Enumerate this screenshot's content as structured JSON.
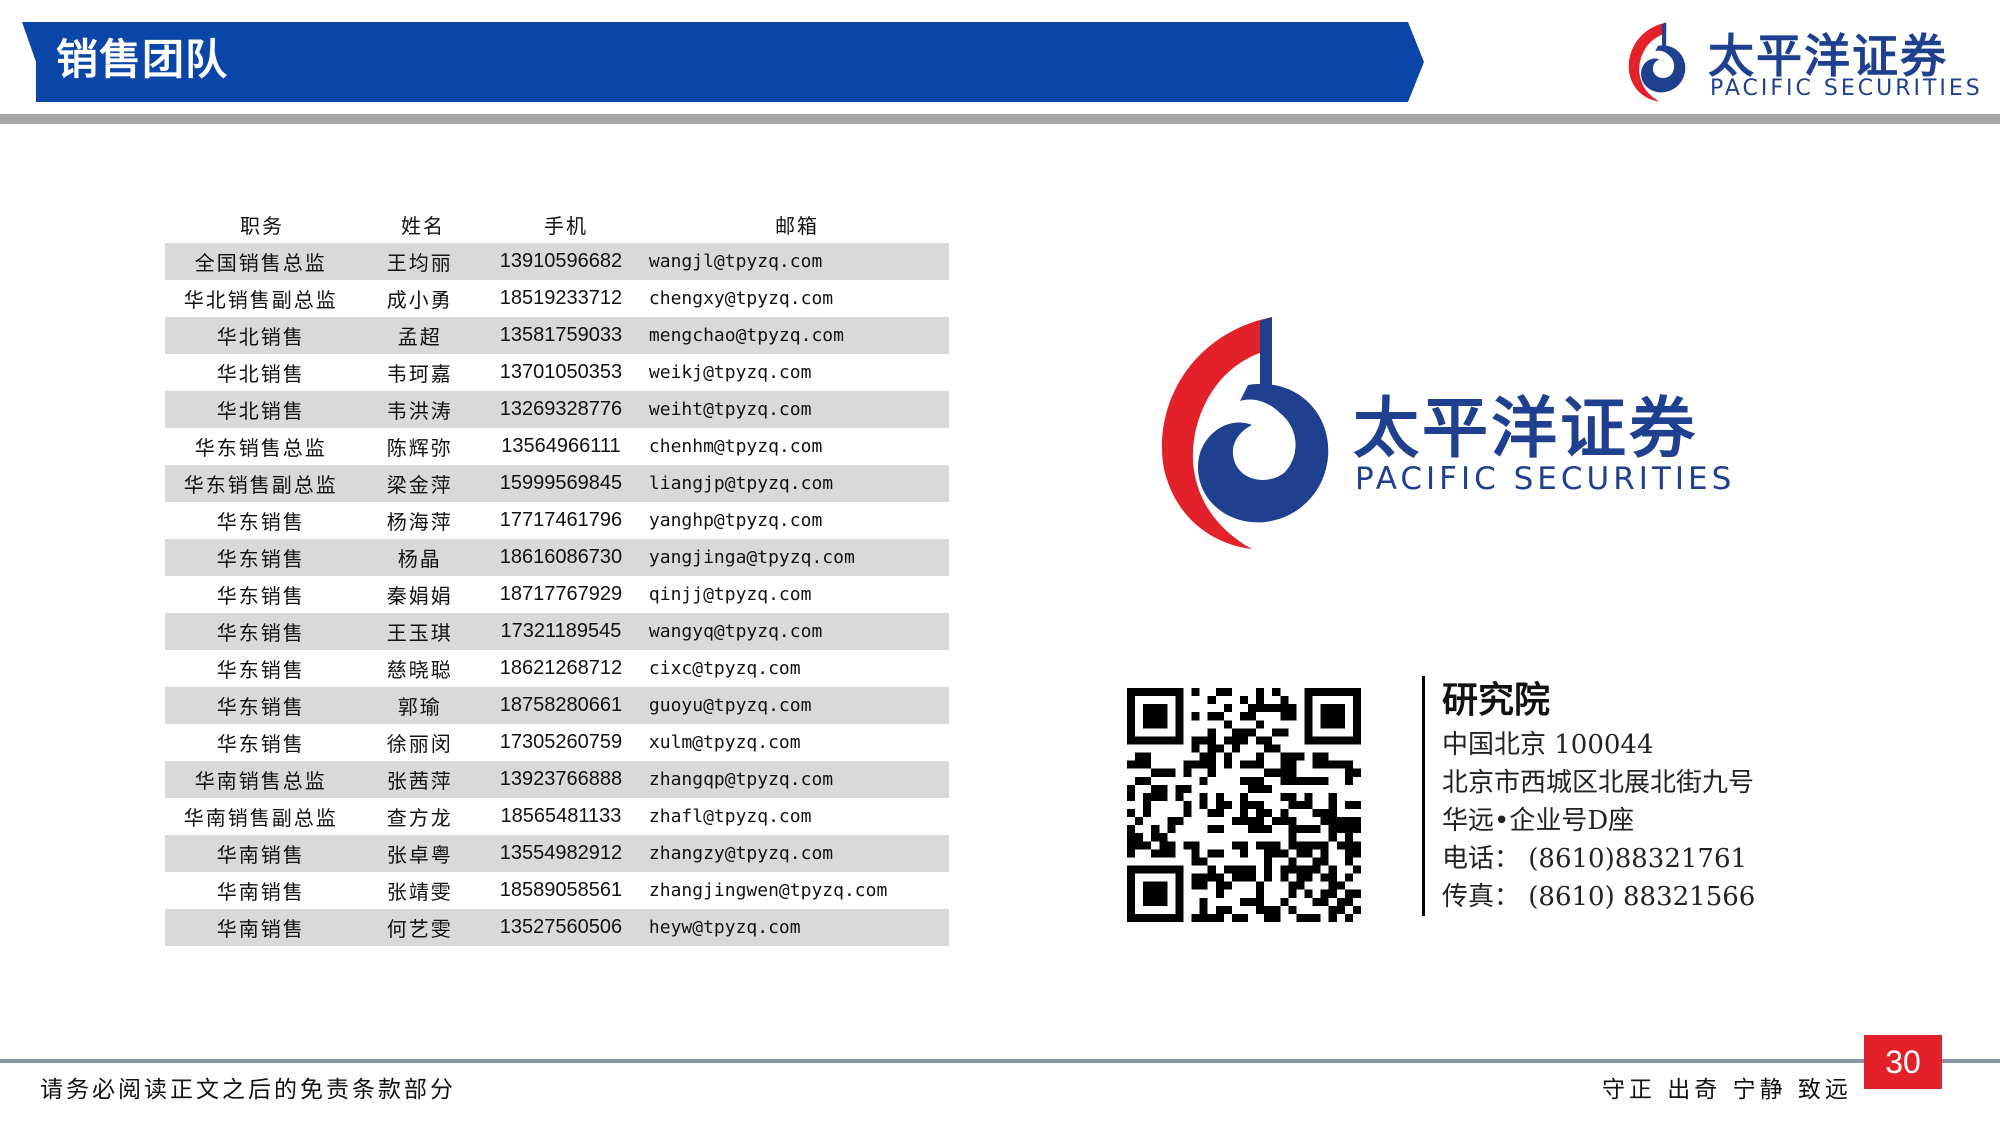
{
  "header": {
    "title": "销售团队",
    "logo_cn": "太平洋证券",
    "logo_en": "PACIFIC SECURITIES"
  },
  "table": {
    "headers": [
      "职务",
      "姓名",
      "手机",
      "邮箱"
    ],
    "rows": [
      {
        "role": "全国销售总监",
        "name": "王均丽",
        "phone": "13910596682",
        "email": "wangjl@tpyzq.com"
      },
      {
        "role": "华北销售副总监",
        "name": "成小勇",
        "phone": "18519233712",
        "email": "chengxy@tpyzq.com"
      },
      {
        "role": "华北销售",
        "name": "孟超",
        "phone": "13581759033",
        "email": "mengchao@tpyzq.com"
      },
      {
        "role": "华北销售",
        "name": "韦珂嘉",
        "phone": "13701050353",
        "email": "weikj@tpyzq.com"
      },
      {
        "role": "华北销售",
        "name": "韦洪涛",
        "phone": "13269328776",
        "email": "weiht@tpyzq.com"
      },
      {
        "role": "华东销售总监",
        "name": "陈辉弥",
        "phone": "13564966111",
        "email": "chenhm@tpyzq.com"
      },
      {
        "role": "华东销售副总监",
        "name": "梁金萍",
        "phone": "15999569845",
        "email": "liangjp@tpyzq.com"
      },
      {
        "role": "华东销售",
        "name": "杨海萍",
        "phone": "17717461796",
        "email": "yanghp@tpyzq.com"
      },
      {
        "role": "华东销售",
        "name": "杨晶",
        "phone": "18616086730",
        "email": "yangjinga@tpyzq.com"
      },
      {
        "role": "华东销售",
        "name": "秦娟娟",
        "phone": "18717767929",
        "email": "qinjj@tpyzq.com"
      },
      {
        "role": "华东销售",
        "name": "王玉琪",
        "phone": "17321189545",
        "email": "wangyq@tpyzq.com"
      },
      {
        "role": "华东销售",
        "name": "慈晓聪",
        "phone": "18621268712",
        "email": "cixc@tpyzq.com"
      },
      {
        "role": "华东销售",
        "name": "郭瑜",
        "phone": "18758280661",
        "email": "guoyu@tpyzq.com"
      },
      {
        "role": "华东销售",
        "name": "徐丽闵",
        "phone": "17305260759",
        "email": "xulm@tpyzq.com"
      },
      {
        "role": "华南销售总监",
        "name": "张茜萍",
        "phone": "13923766888",
        "email": "zhangqp@tpyzq.com"
      },
      {
        "role": "华南销售副总监",
        "name": "查方龙",
        "phone": "18565481133",
        "email": "zhafl@tpyzq.com"
      },
      {
        "role": "华南销售",
        "name": "张卓粤",
        "phone": "13554982912",
        "email": "zhangzy@tpyzq.com"
      },
      {
        "role": "华南销售",
        "name": "张靖雯",
        "phone": "18589058561",
        "email": "zhangjingwen@tpyzq.com"
      },
      {
        "role": "华南销售",
        "name": "何艺雯",
        "phone": "13527560506",
        "email": "heyw@tpyzq.com"
      }
    ]
  },
  "brand": {
    "logo_cn": "太平洋证券",
    "logo_en": "PACIFIC SECURITIES"
  },
  "contact": {
    "title": "研究院",
    "lines": [
      "中国北京 100044",
      "北京市西城区北展北街九号",
      "华远•企业号D座",
      "电话： (8610)88321761",
      "传真： (8610) 88321566"
    ]
  },
  "footer": {
    "disclaimer": "请务必阅读正文之后的免责条款部分",
    "motto": "守正 出奇 宁静 致远",
    "page_number": "30"
  },
  "colors": {
    "banner": "#0a45a8",
    "brand_blue": "#1f3f8f",
    "brand_red": "#e3212b",
    "row_shade": "#d9d9d9"
  }
}
